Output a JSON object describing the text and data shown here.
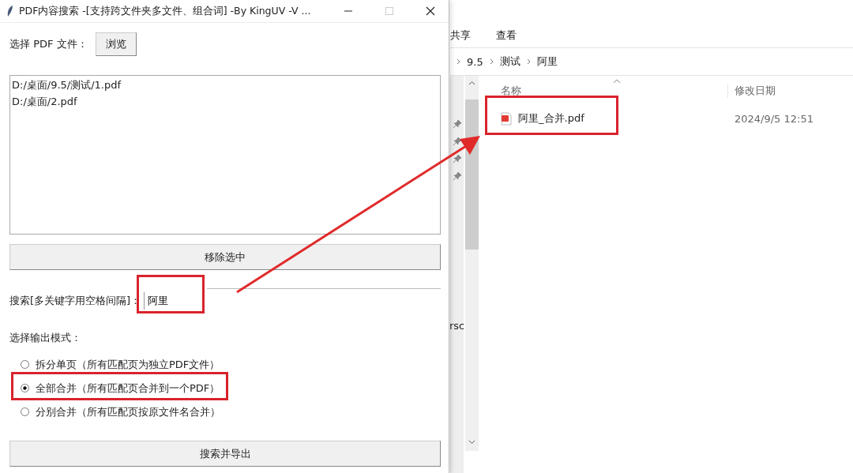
{
  "app_window": {
    "title": "PDF内容搜索  -[支持跨文件夹多文件、组合词]  -By KingUV  -V ...",
    "file_label": "选择 PDF 文件：",
    "browse_button": "浏览",
    "files": [
      "D:/桌面/9.5/测试/1.pdf",
      "D:/桌面/2.pdf"
    ],
    "remove_button": "移除选中",
    "search_label": "搜索[多关键字用空格间隔]：",
    "search_value": "阿里",
    "mode_label": "选择输出模式：",
    "modes": [
      {
        "label": "拆分单页（所有匹配页为独立PDF文件）",
        "selected": false
      },
      {
        "label": "全部合并（所有匹配页合并到一个PDF）",
        "selected": true
      },
      {
        "label": "分别合并（所有匹配页按原文件名合并）",
        "selected": false
      }
    ],
    "export_button": "搜索并导出"
  },
  "explorer": {
    "menu": [
      "共享",
      "查看"
    ],
    "breadcrumb": [
      "9.5",
      "测试",
      "阿里"
    ],
    "columns": [
      "名称",
      "修改日期"
    ],
    "files": [
      {
        "name": "阿里_合并.pdf",
        "modified": "2024/9/5 12:51"
      }
    ],
    "nav_text": "rsc"
  }
}
